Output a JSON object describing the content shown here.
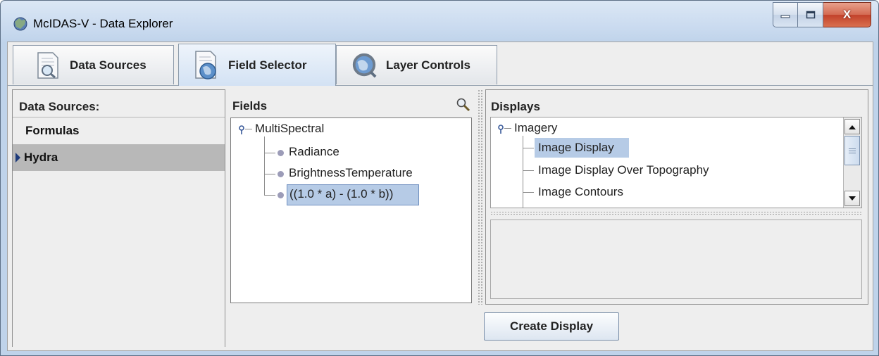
{
  "window": {
    "title": "McIDAS-V - Data Explorer",
    "close_glyph": "X"
  },
  "tabs": [
    {
      "label": "Data Sources",
      "icon": "document-magnifier-icon"
    },
    {
      "label": "Field Selector",
      "icon": "document-globe-icon",
      "active": true
    },
    {
      "label": "Layer Controls",
      "icon": "globe-magnifier-icon"
    }
  ],
  "data_sources": {
    "heading": "Data Sources:",
    "items": [
      {
        "label": "Formulas"
      },
      {
        "label": "Hydra",
        "selected": true
      }
    ]
  },
  "fields": {
    "heading": "Fields",
    "root": "MultiSpectral",
    "children": [
      "Radiance",
      "BrightnessTemperature",
      "((1.0 * a) - (1.0 * b))"
    ],
    "selected_index": 2
  },
  "displays": {
    "heading": "Displays",
    "root": "Imagery",
    "children": [
      "Image Display",
      "Image Display Over Topography",
      "Image Contours"
    ],
    "selected_index": 0
  },
  "actions": {
    "create_display": "Create Display"
  },
  "colors": {
    "selection": "#b6cbe6",
    "titlebar": "#c9daef",
    "close_button": "#c2412a"
  }
}
